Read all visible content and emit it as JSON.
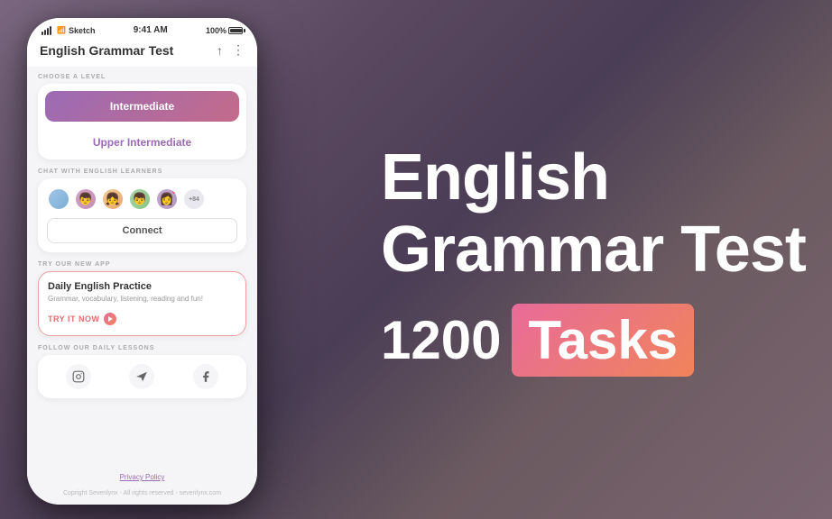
{
  "background": {
    "color1": "#7b6880",
    "color2": "#4a3d55"
  },
  "phone": {
    "status_bar": {
      "carrier": "Sketch",
      "time": "9:41 AM",
      "battery": "100%"
    },
    "header": {
      "title": "English Grammar Test",
      "share_icon": "↑",
      "more_icon": "⋮"
    },
    "levels": {
      "section_label": "CHOOSE A LEVEL",
      "intermediate": "Intermediate",
      "upper_intermediate": "Upper Intermediate"
    },
    "chat": {
      "section_label": "CHAT WITH ENGLISH LEARNERS",
      "more_count": "+84",
      "connect_btn": "Connect"
    },
    "new_app": {
      "section_label": "TRY OUR NEW APP",
      "title": "Daily English Practice",
      "description": "Grammar, vocabulary, listening, reading and fun!",
      "try_label": "TRY IT NOW"
    },
    "social": {
      "section_label": "FOLLOW OUR DAILY LESSONS",
      "instagram": "📷",
      "telegram": "✈",
      "facebook": "f"
    },
    "footer": {
      "privacy": "Privacy Policy",
      "copyright": "Copright Sevenlynx - All rights reserved - sevenlynx.com"
    }
  },
  "right_panel": {
    "title_line1": "English",
    "title_line2": "Grammar Test",
    "count": "1200",
    "tasks_label": "Tasks"
  }
}
